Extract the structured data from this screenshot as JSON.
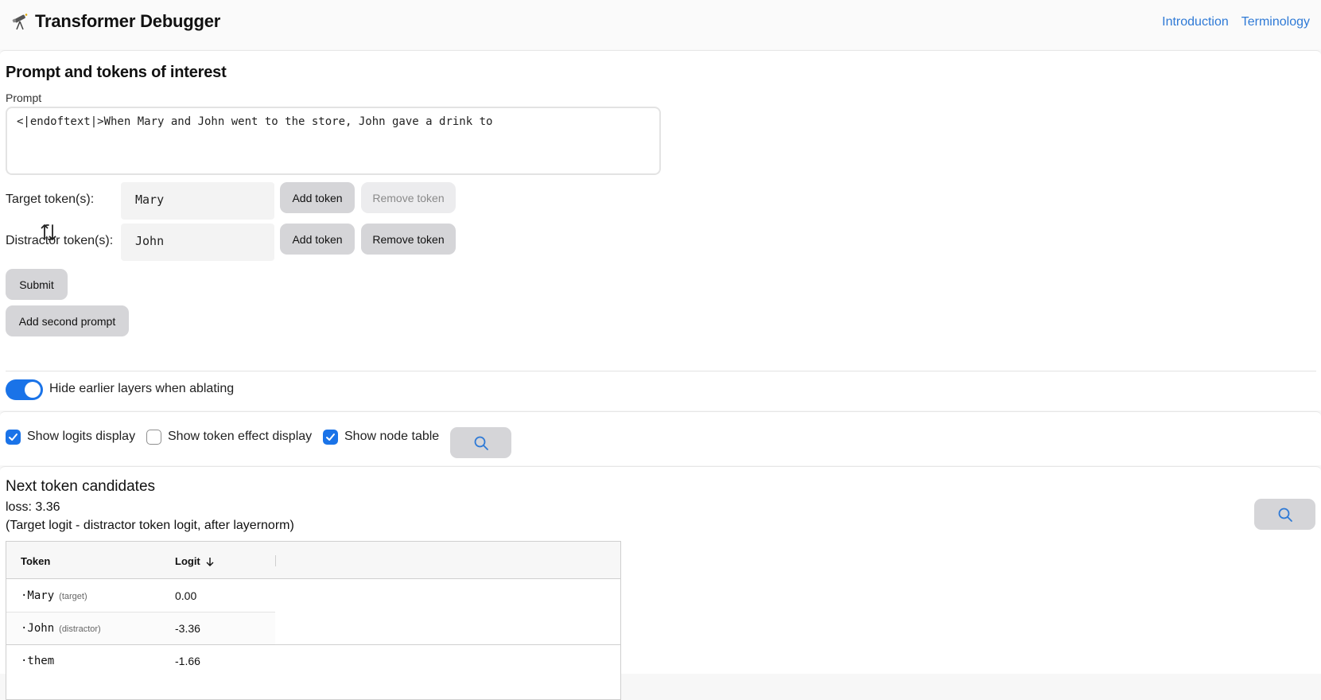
{
  "header": {
    "title": "Transformer Debugger",
    "logo_icon": "telescope-icon",
    "nav": [
      {
        "label": "Introduction"
      },
      {
        "label": "Terminology"
      }
    ]
  },
  "prompt_section": {
    "title": "Prompt and tokens of interest",
    "prompt_label": "Prompt",
    "prompt_value": "<|endoftext|>When Mary and John went to the store, John gave a drink to",
    "target_label": "Target token(s):",
    "target_value": "Mary",
    "distractor_label": "Distractor token(s):",
    "distractor_value": "John",
    "add_token_label": "Add token",
    "remove_token_label": "Remove token",
    "submit_label": "Submit",
    "add_second_prompt_label": "Add second prompt",
    "hide_layers_label": "Hide earlier layers when ablating",
    "hide_layers_on": true
  },
  "display_toggles": {
    "logits_label": "Show logits display",
    "logits_checked": true,
    "token_effect_label": "Show token effect display",
    "token_effect_checked": false,
    "node_table_label": "Show node table",
    "node_table_checked": true
  },
  "results": {
    "title": "Next token candidates",
    "loss": "loss: 3.36",
    "note": "(Target logit - distractor token logit, after layernorm)",
    "columns": [
      "Token",
      "Logit"
    ],
    "rows": [
      {
        "token": "·Mary",
        "tag": "(target)",
        "value": "0.00"
      },
      {
        "token": "·John",
        "tag": "(distractor)",
        "value": "-3.36"
      },
      {
        "token": "·them",
        "tag": "",
        "value": "-1.66"
      }
    ]
  },
  "colors": {
    "accent": "#1a73e8",
    "link": "#2f7ad6",
    "button_bg": "#d5d5d8"
  }
}
